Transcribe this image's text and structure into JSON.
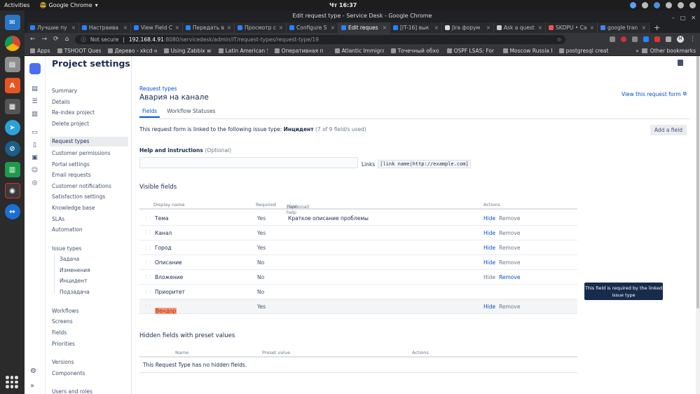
{
  "os": {
    "activities": "Activities",
    "app_name": "Google Chrome",
    "app_menu_caret": "▾",
    "clock": "Чт 16:37"
  },
  "window": {
    "title": "Edit request type - Service Desk - Google Chrome",
    "controls": [
      "–",
      "□",
      "✕"
    ]
  },
  "tabs": [
    {
      "label": "Лучшие пу",
      "active": false
    },
    {
      "label": "Настраива",
      "active": false
    },
    {
      "label": "View Field C",
      "active": false
    },
    {
      "label": "Передать в",
      "active": false
    },
    {
      "label": "Просмотр с",
      "active": false
    },
    {
      "label": "Configure S",
      "active": false
    },
    {
      "label": "Edit reques",
      "active": true
    },
    {
      "label": "[IT-16] вык",
      "active": false
    },
    {
      "label": "Jira форум",
      "active": false
    },
    {
      "label": "Ask a quest",
      "active": false
    },
    {
      "label": "SKDPU • Ca",
      "active": false
    },
    {
      "label": "google tran",
      "active": false
    }
  ],
  "tab_close": "×",
  "new_tab": "+",
  "omnibox": {
    "security": "Not secure",
    "host": "192.168.4.91",
    "path": ":8080/servicedesk/admin/IT/request-types/request-type/19",
    "profile_initial": "M",
    "nav": [
      "←",
      "→",
      "⟳",
      "⌂"
    ]
  },
  "bookmarks": [
    "Apps",
    "TSHOOT Questi",
    "Дерево - xkcd н",
    "Using Zabbix wi",
    "Latin American S",
    "Оперативная п",
    "Atlantic Immigra",
    "Точечный обхо",
    "OSPF LSAS: For",
    "Moscow Russia E",
    "postgresql creat"
  ],
  "bookmarks_more": "»",
  "other_bookmarks": "Other bookmarks",
  "sidebar": {
    "heading": "Project settings",
    "group1": [
      "Summary",
      "Details",
      "Re-index project",
      "Delete project"
    ],
    "group2": [
      "Request types",
      "Customer permissions",
      "Portal settings",
      "Email requests",
      "Customer notifications",
      "Satisfaction settings",
      "Knowledge base",
      "SLAs",
      "Automation"
    ],
    "issue_types_label": "Issue types",
    "issue_types": [
      "Задача",
      "Изменения",
      "Инцидент",
      "Подзадача"
    ],
    "group3": [
      "Workflows",
      "Screens",
      "Fields",
      "Priorities"
    ],
    "group4": [
      "Versions",
      "Components"
    ],
    "group5": [
      "Users and roles"
    ]
  },
  "main": {
    "breadcrumb": "Request types",
    "title": "Авария на канале",
    "view_form_link": "View this request form",
    "tabs": [
      "Fields",
      "Workflow Statuses"
    ],
    "linked_prefix": "This request form is linked to the following issue type:",
    "linked_type": "Инцидент",
    "linked_count": "(7 of 9 field/s used)",
    "add_field": "Add a field",
    "help_label": "Help and instructions",
    "help_optional": "(Optional)",
    "links_label": "Links",
    "links_code": "[link name|http://example.com]",
    "visible_title": "Visible fields",
    "columns": {
      "display": "Display name",
      "required": "Required",
      "help": "Field help",
      "help_opt": "(Optional)",
      "actions": "Actions"
    },
    "rows": [
      {
        "name": "Тема",
        "required": "Yes",
        "help": "Краткое описание проблемы",
        "hide": "Hide",
        "remove": "Remove"
      },
      {
        "name": "Канал",
        "required": "Yes",
        "help": "",
        "hide": "Hide",
        "remove": "Remove"
      },
      {
        "name": "Город",
        "required": "Yes",
        "help": "",
        "hide": "Hide",
        "remove": "Remove"
      },
      {
        "name": "Описание",
        "required": "No",
        "help": "",
        "hide": "Hide",
        "remove": "Remove"
      },
      {
        "name": "Вложение",
        "required": "No",
        "help": "",
        "hide": "Hide",
        "remove": "Remove"
      },
      {
        "name": "Приоритет",
        "required": "No",
        "help": "",
        "hide": "",
        "remove": ""
      },
      {
        "name": "Вендор",
        "required": "Yes",
        "help": "",
        "hide": "Hide",
        "remove": "Remove"
      }
    ],
    "tooltip": "This field is required by the linked issue type",
    "hidden_title": "Hidden fields with preset values",
    "hidden_columns": {
      "name": "Name",
      "preset": "Preset value",
      "actions": "Actions"
    },
    "hidden_empty": "This Request Type has no hidden fields."
  },
  "colors": {
    "accent": "#0052cc",
    "dock": "#2b2b2b",
    "chrome_dark": "#202124"
  }
}
